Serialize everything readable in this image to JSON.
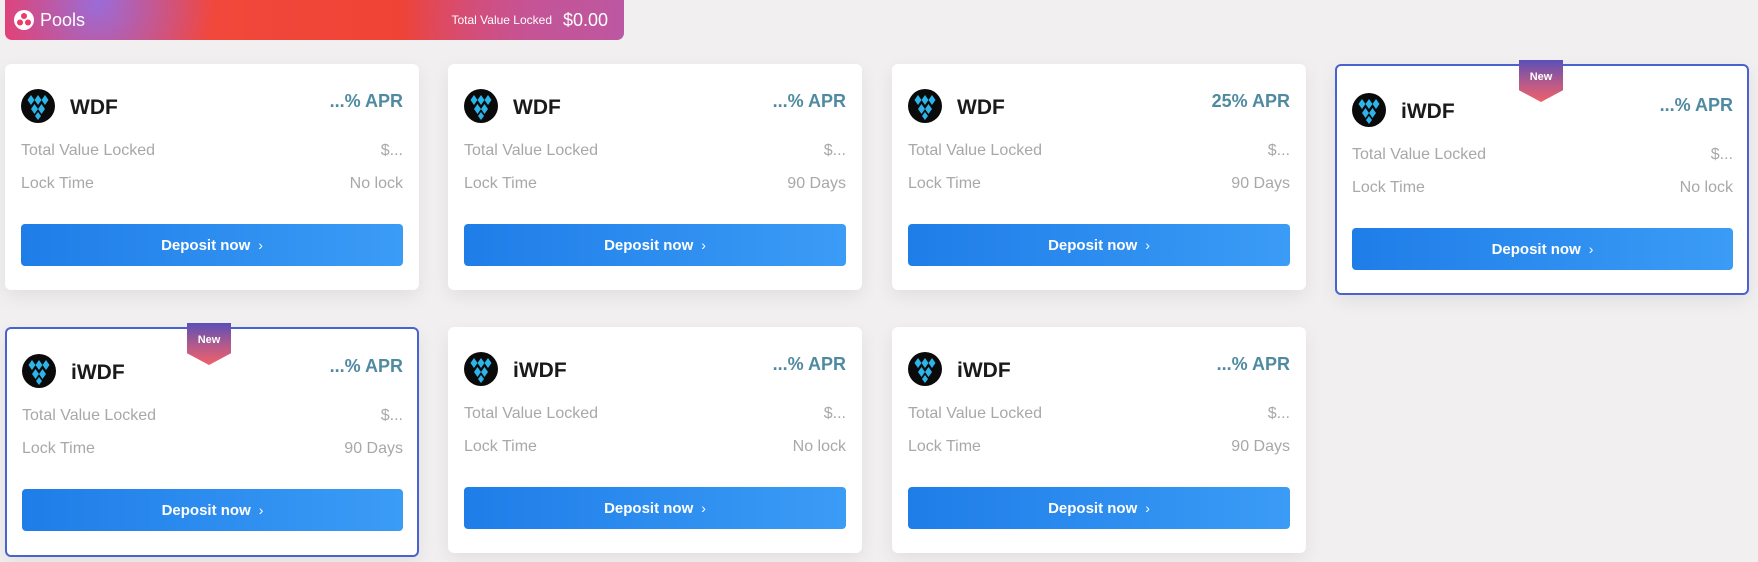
{
  "header": {
    "title": "Pools",
    "tvl_label": "Total Value Locked",
    "tvl_value": "$0.00"
  },
  "labels": {
    "tvl": "Total Value Locked",
    "lock_time": "Lock Time",
    "deposit": "Deposit now",
    "new_badge": "New"
  },
  "pools": [
    {
      "token": "WDF",
      "apr": "...% APR",
      "tvl": "$...",
      "lock": "No lock"
    },
    {
      "token": "WDF",
      "apr": "...% APR",
      "tvl": "$...",
      "lock": "90 Days"
    },
    {
      "token": "WDF",
      "apr": "25% APR",
      "tvl": "$...",
      "lock": "90 Days"
    },
    {
      "token": "iWDF",
      "apr": "...% APR",
      "tvl": "$...",
      "lock": "No lock"
    },
    {
      "token": "iWDF",
      "apr": "...% APR",
      "tvl": "$...",
      "lock": "90 Days"
    },
    {
      "token": "iWDF",
      "apr": "...% APR",
      "tvl": "$...",
      "lock": "No lock"
    },
    {
      "token": "iWDF",
      "apr": "...% APR",
      "tvl": "$...",
      "lock": "90 Days"
    }
  ],
  "icons": {
    "header": "pools-icon",
    "token": "wdf-token-logo-icon",
    "deposit": "chevron-right-icon"
  },
  "colors": {
    "apr": "#4f8aa1",
    "button": "#2b8af0",
    "new_border": "#4a62cf",
    "muted_text": "#a8a8a8"
  }
}
